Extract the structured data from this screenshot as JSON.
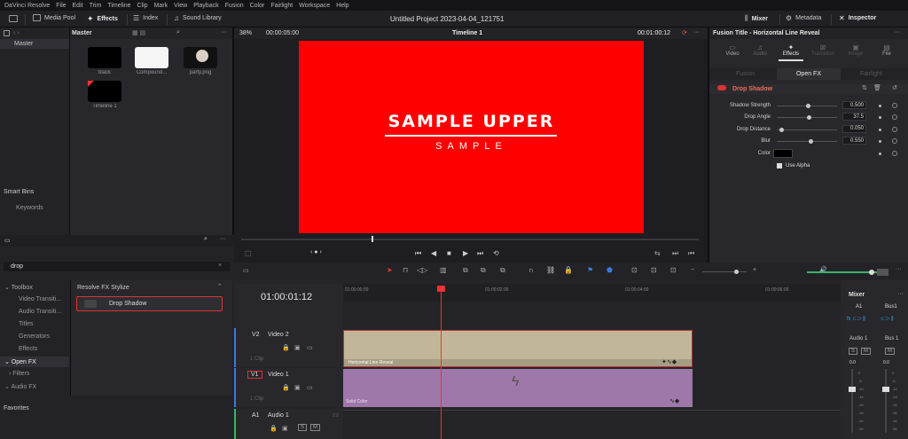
{
  "menubar": {
    "items": [
      "DaVinci Resolve",
      "File",
      "Edit",
      "Trim",
      "Timeline",
      "Clip",
      "Mark",
      "View",
      "Playback",
      "Fusion",
      "Color",
      "Fairlight",
      "Workspace",
      "Help"
    ]
  },
  "toolbar": {
    "media_pool": "Media Pool",
    "effects": "Effects",
    "index": "Index",
    "sound_library": "Sound Library",
    "project_title": "Untitled Project 2023-04-04_121751",
    "mixer": "Mixer",
    "metadata": "Metadata",
    "inspector": "Inspector"
  },
  "media_pool": {
    "master_label": "Master",
    "bin_master": "Master",
    "smart_bins": "Smart Bins",
    "keywords": "Keywords",
    "clips": [
      {
        "name": "black"
      },
      {
        "name": "Compound..."
      },
      {
        "name": "party.png"
      },
      {
        "name": "Timeline 1"
      }
    ]
  },
  "viewer": {
    "zoom": "38%",
    "duration": "00:00:05:00",
    "timeline_name": "Timeline 1",
    "timecode": "00:01:00:12",
    "title_text": "SAMPLE UPPER",
    "subtitle_text": "SAMPLE",
    "title_color": "#ffffff",
    "background_color": "#ff0000"
  },
  "effects": {
    "search_value": "drop",
    "tree": [
      {
        "label": "Toolbox"
      },
      {
        "label": "Video Transiti..."
      },
      {
        "label": "Audio Transiti..."
      },
      {
        "label": "Titles"
      },
      {
        "label": "Generators"
      },
      {
        "label": "Effects"
      },
      {
        "label": "Open FX"
      },
      {
        "label": "Filters"
      },
      {
        "label": "Audio FX"
      }
    ],
    "favorites": "Favorites",
    "category": "Resolve FX Stylize",
    "result": "Drop Shadow"
  },
  "timeline": {
    "timecode": "01:00:01:12",
    "ruler": [
      "01:00:00:00",
      "01:00:02:00",
      "01:00:04:00",
      "01:00:06:00"
    ],
    "tracks": [
      {
        "id": "V2",
        "name": "Video 2",
        "clips": "1 Clip",
        "clip_label": "Horizontal Line Reveal"
      },
      {
        "id": "V1",
        "name": "Video 1",
        "clips": "1 Clip",
        "clip_label": "Solid Color"
      },
      {
        "id": "A1",
        "name": "Audio 1",
        "channels": "2.0"
      }
    ]
  },
  "inspector": {
    "title": "Fusion Title - Horizontal Line Reveal",
    "tabs": [
      "Video",
      "Audio",
      "Effects",
      "Transition",
      "Image",
      "File"
    ],
    "subtabs": [
      "Fusion",
      "Open FX",
      "Fairlight"
    ],
    "effect_name": "Drop Shadow",
    "params": [
      {
        "label": "Shadow Strength",
        "value": "0.500",
        "pos": 0.5
      },
      {
        "label": "Drop Angle",
        "value": "37.5",
        "pos": 0.52
      },
      {
        "label": "Drop Distance",
        "value": "0.050",
        "pos": 0.05
      },
      {
        "label": "Blur",
        "value": "0.550",
        "pos": 0.55
      }
    ],
    "color_label": "Color",
    "use_alpha": "Use Alpha"
  },
  "mixer": {
    "title": "Mixer",
    "channels": [
      "A1",
      "Bus1"
    ],
    "strips": [
      "Audio 1",
      "Bus 1"
    ],
    "levels": [
      "0.0",
      "0.0"
    ],
    "scale": [
      "0",
      "-5",
      "-10",
      "-15",
      "-20",
      "-30",
      "-40",
      "-50"
    ]
  }
}
